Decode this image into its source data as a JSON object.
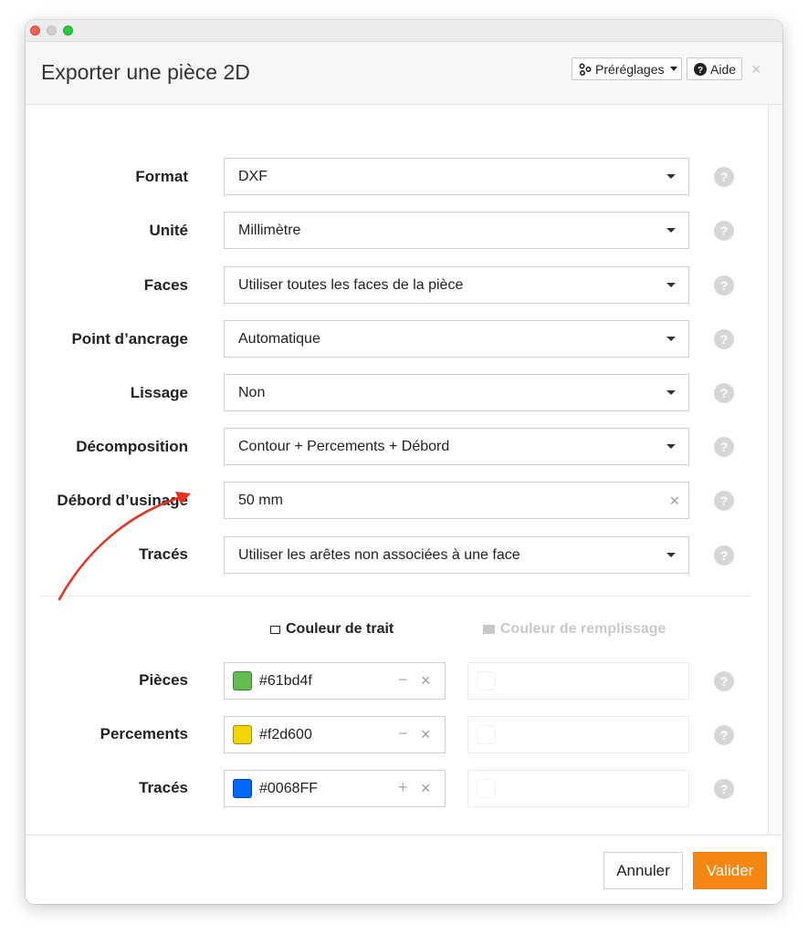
{
  "window": {
    "title": "Exporter une pièce 2D"
  },
  "header": {
    "presets_label": "Préréglages",
    "help_label": "Aide",
    "close_symbol": "×"
  },
  "form": {
    "rows": [
      {
        "label": "Format",
        "value": "DXF",
        "control": "select"
      },
      {
        "label": "Unité",
        "value": "Millimètre",
        "control": "select"
      },
      {
        "label": "Faces",
        "value": "Utiliser toutes les faces de la pièce",
        "control": "select"
      },
      {
        "label": "Point d’ancrage",
        "value": "Automatique",
        "control": "select"
      },
      {
        "label": "Lissage",
        "value": "Non",
        "control": "select"
      },
      {
        "label": "Décomposition",
        "value": "Contour + Percements + Débord",
        "control": "select"
      },
      {
        "label": "Débord d’usinage",
        "value": "50 mm",
        "control": "input-clearable"
      },
      {
        "label": "Tracés",
        "value": "Utiliser les arêtes non associées à une face",
        "control": "select"
      }
    ],
    "help_symbol": "?"
  },
  "colors": {
    "stroke_header": "Couleur de trait",
    "fill_header": "Couleur de remplissage",
    "rows": [
      {
        "label": "Pièces",
        "hex": "#61bd4f",
        "swatch": "#61bd4f",
        "action": "−"
      },
      {
        "label": "Percements",
        "hex": "#f2d600",
        "swatch": "#f2d600",
        "action": "−"
      },
      {
        "label": "Tracés",
        "hex": "#0068FF",
        "swatch": "#0068FF",
        "action": "+"
      }
    ],
    "clear_symbol": "×"
  },
  "footer": {
    "cancel_label": "Annuler",
    "confirm_label": "Valider"
  },
  "theme": {
    "accent": "#f58611",
    "annotation_arrow": "#e8321e"
  },
  "icons": {
    "presets": "presets-icon",
    "help": "question-circle-icon",
    "close": "close-icon",
    "dropdown": "caret-down-icon",
    "field_help": "help-circle-icon",
    "stroke": "square-outline-icon",
    "fill": "square-filled-icon"
  }
}
